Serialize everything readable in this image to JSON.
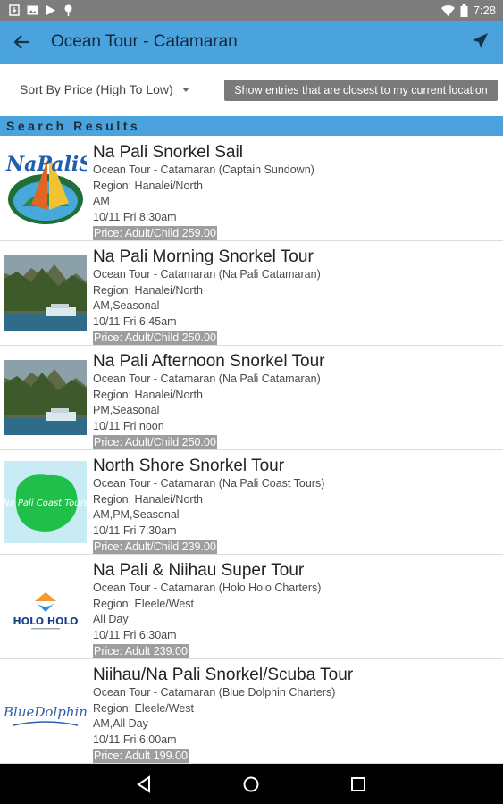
{
  "status_bar": {
    "time": "7:28"
  },
  "app_bar": {
    "title": "Ocean Tour - Catamaran"
  },
  "sort": {
    "label": "Sort By Price (High To Low)"
  },
  "tooltip": "Show entries that are closest to my current location",
  "section_header": "Search Results",
  "results": [
    {
      "name": "Na Pali Snorkel Sail",
      "category": "Ocean Tour - Catamaran (Captain Sundown)",
      "region": "Region: Hanalei/North",
      "time_of_day": "AM",
      "date": "10/11 Fri 8:30am",
      "price": "Price: Adult/Child 259.00",
      "thumb": "na-pali-sail-logo",
      "logo_text": "NaPaliSail"
    },
    {
      "name": "Na Pali Morning Snorkel Tour",
      "category": "Ocean Tour - Catamaran (Na Pali Catamaran)",
      "region": "Region: Hanalei/North",
      "time_of_day": "AM,Seasonal",
      "date": "10/11 Fri 6:45am",
      "price": "Price: Adult/Child 250.00",
      "thumb": "coast-boat-photo"
    },
    {
      "name": "Na Pali Afternoon Snorkel Tour",
      "category": "Ocean Tour - Catamaran (Na Pali Catamaran)",
      "region": "Region: Hanalei/North",
      "time_of_day": "PM,Seasonal",
      "date": "10/11 Fri noon",
      "price": "Price: Adult/Child 250.00",
      "thumb": "coast-boat-photo"
    },
    {
      "name": "North Shore Snorkel Tour",
      "category": "Ocean Tour - Catamaran (Na Pali Coast Tours)",
      "region": "Region: Hanalei/North",
      "time_of_day": "AM,PM,Seasonal",
      "date": "10/11 Fri 7:30am",
      "price": "Price: Adult/Child 239.00",
      "thumb": "na-pali-coast-tours-logo",
      "logo_text": "Na Pali Coast Tours"
    },
    {
      "name": "Na Pali & Niihau Super Tour",
      "category": "Ocean Tour - Catamaran (Holo Holo Charters)",
      "region": "Region: Eleele/West",
      "time_of_day": "All Day",
      "date": "10/11 Fri 6:30am",
      "price": "Price: Adult 239.00",
      "thumb": "holo-holo-logo",
      "logo_text": "HOLO HOLO"
    },
    {
      "name": "Niihau/Na Pali Snorkel/Scuba Tour",
      "category": "Ocean Tour - Catamaran (Blue Dolphin Charters)",
      "region": "Region: Eleele/West",
      "time_of_day": "AM,All Day",
      "date": "10/11 Fri 6:00am",
      "price": "Price: Adult 199.00",
      "thumb": "blue-dolphin-logo",
      "logo_text": "BlueDolphin"
    }
  ]
}
